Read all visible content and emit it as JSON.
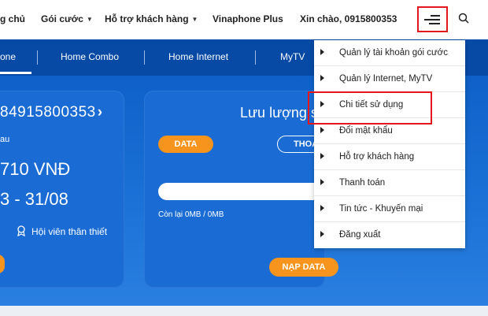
{
  "topnav": {
    "items": [
      {
        "label": "g chủ",
        "has_caret": false
      },
      {
        "label": "Gói cước",
        "has_caret": true
      },
      {
        "label": "Hỗ trợ khách hàng",
        "has_caret": true
      },
      {
        "label": "Vinaphone Plus",
        "has_caret": false
      },
      {
        "label": "Xin chào, 0915800353",
        "has_caret": false
      }
    ],
    "menu_icon": "hamburger-menu-icon",
    "search_icon": "search-icon"
  },
  "tabs": [
    {
      "label": "one",
      "active": true
    },
    {
      "label": "Home Combo",
      "active": false
    },
    {
      "label": "Home Internet",
      "active": false
    },
    {
      "label": "MyTV",
      "active": false
    }
  ],
  "account_card": {
    "phone": "84915800353",
    "chevron": "›",
    "sub_label": "au",
    "balance": "710 VNĐ",
    "period": "3 - 31/08",
    "member_label": "Hội viên thân thiết"
  },
  "usage_card": {
    "title": "Lưu lượng s",
    "tab_data": "DATA",
    "tab_call": "THOA",
    "remaining": "Còn lại 0MB / 0MB",
    "remaining_fraction": 0,
    "button": "NẠP DATA"
  },
  "dropdown": {
    "items": [
      "Quản lý tài khoản gói cước",
      "Quản lý Internet, MyTV",
      "Chi tiết sử dụng",
      "Đổi mật khẩu",
      "Hỗ trợ khách hàng",
      "Thanh toán",
      "Tin tức - Khuyến mại",
      "Đăng xuất"
    ],
    "highlighted_index": 2
  },
  "colors": {
    "brand_blue": "#0b5cc4",
    "accent_orange": "#f7941d",
    "highlight_red": "#e3171d"
  }
}
